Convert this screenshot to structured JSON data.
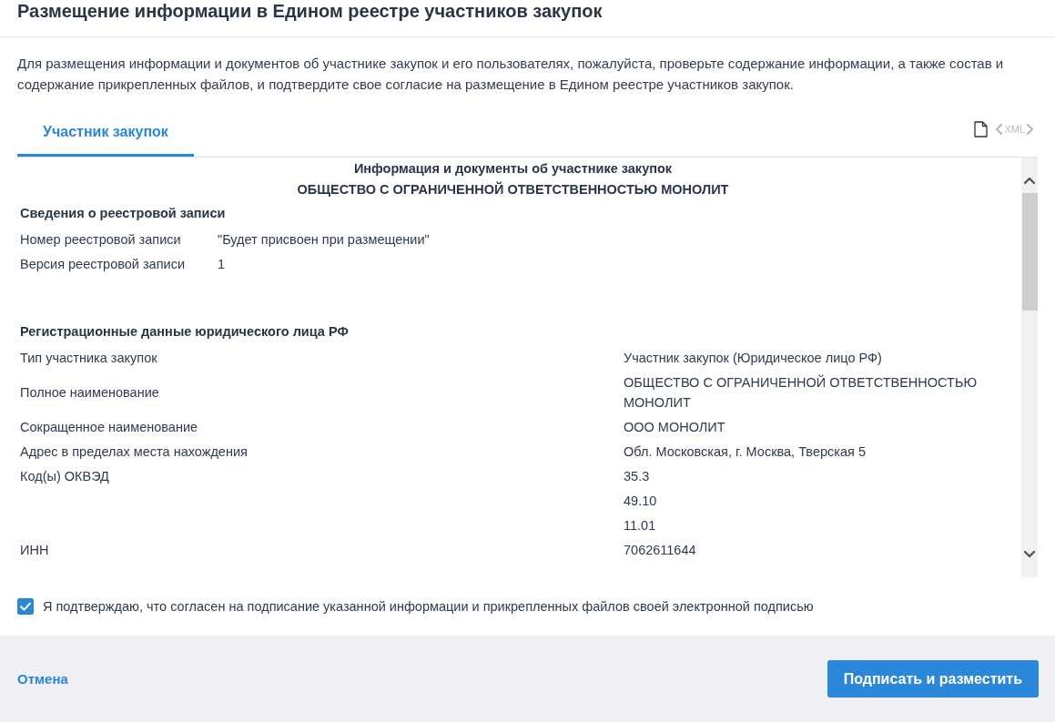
{
  "dialog": {
    "title": "Размещение информации в Едином реестре участников закупок",
    "description": "Для размещения информации и документов об участнике закупок и его пользователях, пожалуйста, проверьте содержание информации, а также состав и содержание прикрепленных файлов, и подтвердите свое согласие на размещение в Едином реестре участников закупок."
  },
  "tabs": [
    {
      "label": "Участник закупок",
      "selected": true
    }
  ],
  "toolbar": {
    "xml_link": {
      "label": "XML",
      "disabled": true
    }
  },
  "document": {
    "heading": "Информация и документы об участнике закупок",
    "subject": "ОБЩЕСТВО С ОГРАНИЧЕННОЙ ОТВЕТСТВЕННОСТЬЮ МОНОЛИТ",
    "sections": [
      {
        "kind": "inline",
        "title": "Сведения о реестровой записи",
        "fields": [
          {
            "label": "Номер реестровой записи",
            "values": [
              "\"Будет присвоен при размещении\""
            ]
          },
          {
            "label": "Версия реестровой записи",
            "values": [
              "1"
            ]
          }
        ]
      },
      {
        "kind": "columns",
        "title": "Регистрационные данные юридического лица РФ",
        "fields": [
          {
            "label": "Тип участника закупок",
            "values": [
              "Участник закупок (Юридическое лицо РФ)"
            ]
          },
          {
            "label": "Полное наименование",
            "values": [
              "ОБЩЕСТВО С ОГРАНИЧЕННОЙ ОТВЕТСТВЕННОСТЬЮ МОНОЛИТ"
            ]
          },
          {
            "label": "Сокращенное наименование",
            "values": [
              "ООО МОНОЛИТ"
            ]
          },
          {
            "label": "Адрес в пределах места нахождения",
            "values": [
              "Обл. Московская, г. Москва, Тверская 5"
            ]
          },
          {
            "label": "Код(ы) ОКВЭД",
            "values": [
              "35.3",
              "49.10",
              "11.01"
            ]
          },
          {
            "label": "ИНН",
            "values": [
              "7062611644"
            ]
          }
        ]
      }
    ]
  },
  "consent": {
    "label": "Я подтверждаю, что согласен на подписание указанной информации и прикрепленных файлов своей электронной подписью",
    "checked": true
  },
  "footer": {
    "cancel": "Отмена",
    "submit": "Подписать и разместить"
  }
}
